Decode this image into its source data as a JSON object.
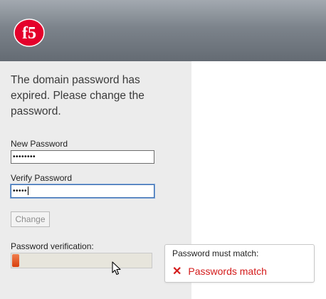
{
  "brand": {
    "logo_text": "f5",
    "logo_color": "#e4002b"
  },
  "message": "The domain password has expired. Please change the password.",
  "new_password": {
    "label": "New Password",
    "value": "••••••••"
  },
  "verify_password": {
    "label": "Verify Password",
    "value": "•••••"
  },
  "change_button": {
    "label": "Change"
  },
  "verification": {
    "label": "Password verification:",
    "progress": 0.05
  },
  "tooltip": {
    "title": "Password must match:",
    "status_icon": "x-icon",
    "status": "Passwords match",
    "status_glyph": "✕",
    "status_color": "#d41b1b"
  }
}
